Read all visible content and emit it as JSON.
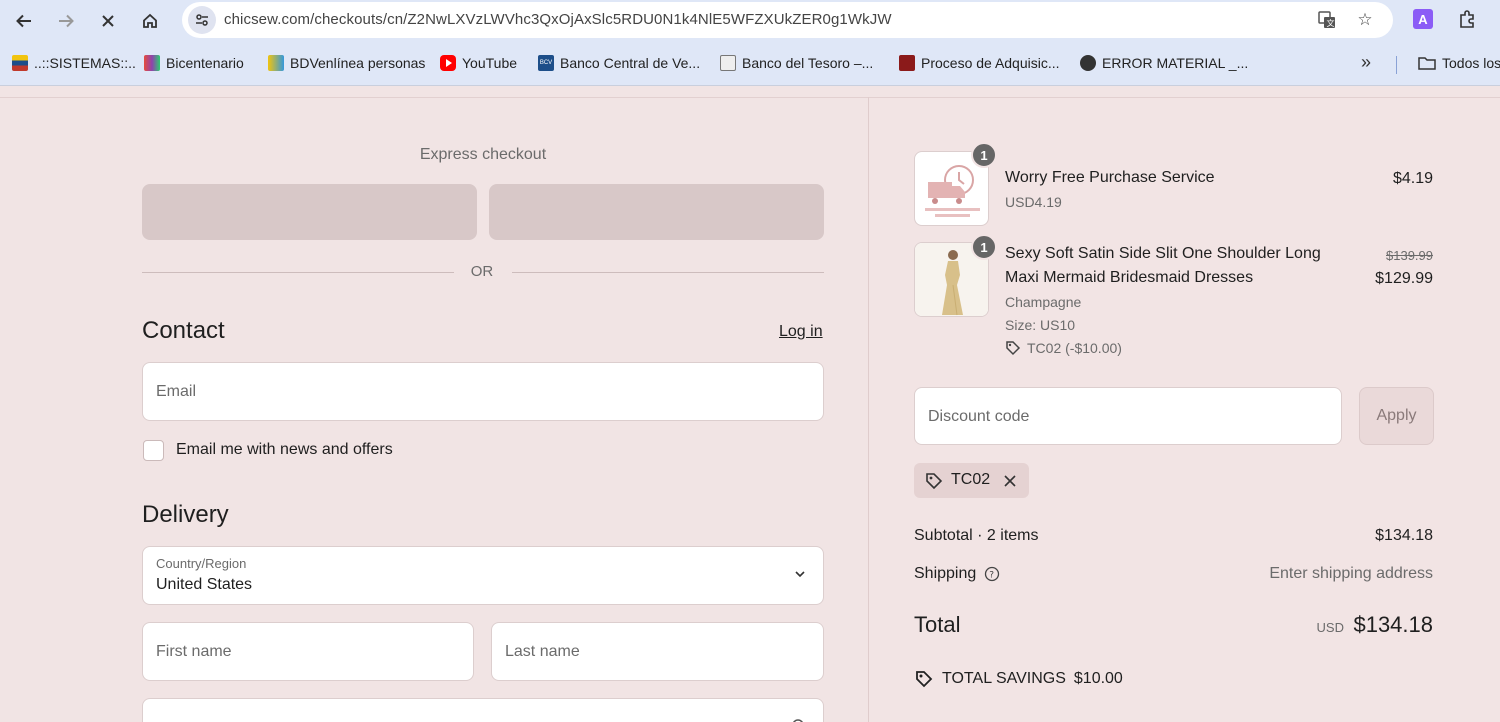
{
  "browser": {
    "url": "chicsew.com/checkouts/cn/Z2NwLXVzLWVhc3QxOjAxSlc5RDU0N1k4NlE5WFZXUkZER0g1WkJW",
    "profile_initial": "A",
    "bookmarks": [
      {
        "label": "..::SISTEMAS::..",
        "color": "#c0392b"
      },
      {
        "label": "Bicentenario",
        "color": "#e74c3c"
      },
      {
        "label": "BDVenlínea personas",
        "color": "#f1c40f"
      },
      {
        "label": "YouTube",
        "color": "#ff0000"
      },
      {
        "label": "Banco Central de Ve...",
        "color": "#1d4e89"
      },
      {
        "label": "Banco del Tesoro –...",
        "color": "#777777"
      },
      {
        "label": "Proceso de Adquisic...",
        "color": "#8b1a1a"
      },
      {
        "label": "ERROR MATERIAL _...",
        "color": "#333333"
      }
    ],
    "more_bookmarks": "»",
    "all_bookmarks": "Todos los"
  },
  "checkout": {
    "express_title": "Express checkout",
    "or_text": "OR",
    "contact_title": "Contact",
    "login_label": "Log in",
    "email_placeholder": "Email",
    "newsletter_label": "Email me with news and offers",
    "delivery_title": "Delivery",
    "country_label": "Country/Region",
    "country_value": "United States",
    "first_name_placeholder": "First name",
    "last_name_placeholder": "Last name"
  },
  "summary": {
    "items": [
      {
        "name": "Worry Free Purchase Service",
        "sub": "USD4.19",
        "price": "$4.19",
        "qty": "1"
      },
      {
        "name_line1": "Sexy Soft Satin Side Slit One Shoulder Long",
        "name_line2": "Maxi Mermaid Bridesmaid Dresses",
        "color": "Champagne",
        "size": "Size: US10",
        "discount": "TC02 (-$10.00)",
        "price_old": "$139.99",
        "price": "$129.99",
        "qty": "1"
      }
    ],
    "discount_placeholder": "Discount code",
    "apply_label": "Apply",
    "applied_code": "TC02",
    "subtotal_label": "Subtotal · 2 items",
    "subtotal_value": "$134.18",
    "shipping_label": "Shipping",
    "shipping_value": "Enter shipping address",
    "total_label": "Total",
    "total_currency": "USD",
    "total_value": "$134.18",
    "savings_label": "TOTAL SAVINGS",
    "savings_value": "$10.00"
  }
}
